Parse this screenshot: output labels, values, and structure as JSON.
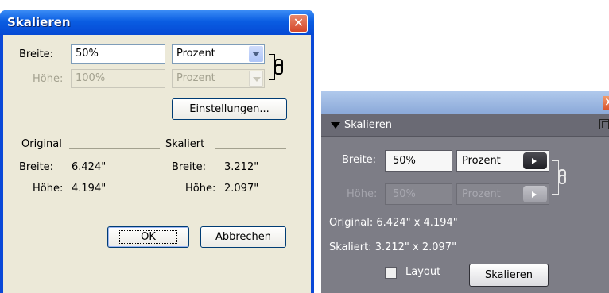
{
  "dialog": {
    "title": "Skalieren",
    "width_label": "Breite:",
    "width_value": "50%",
    "width_unit": "Prozent",
    "height_label": "Höhe:",
    "height_value": "100%",
    "height_unit": "Prozent",
    "settings_button": "Einstellungen...",
    "original_label": "Original",
    "scaled_label": "Skaliert",
    "orig_width_label": "Breite:",
    "orig_width_value": "6.424\"",
    "orig_height_label": "Höhe:",
    "orig_height_value": "4.194\"",
    "scaled_width_label": "Breite:",
    "scaled_width_value": "3.212\"",
    "scaled_height_label": "Höhe:",
    "scaled_height_value": "2.097\"",
    "ok_button": "OK",
    "cancel_button": "Abbrechen"
  },
  "panel": {
    "title": "Skalieren",
    "width_label": "Breite:",
    "width_value": "50%",
    "width_unit": "Prozent",
    "height_label": "Höhe:",
    "height_value": "50%",
    "height_unit": "Prozent",
    "original_text": "Original: 6.424\" x 4.194\"",
    "scaled_text": "Skaliert: 3.212\" x 2.097\"",
    "layout_label": "Layout",
    "scale_button": "Skalieren"
  }
}
